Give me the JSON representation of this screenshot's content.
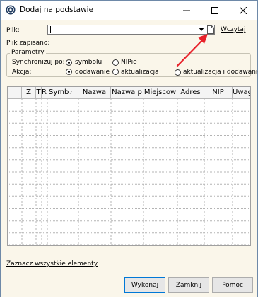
{
  "window": {
    "title": "Dodaj na podstawie",
    "icon": "app-logo-icon"
  },
  "file": {
    "label": "Plik:",
    "value": "",
    "load_label": "Wczytaj",
    "saved_label": "Plik zapisano:"
  },
  "params": {
    "legend": "Parametry",
    "sync_label": "Synchronizuj po:",
    "sync_options": [
      "symbolu",
      "NIPie"
    ],
    "sync_selected": "symbolu",
    "action_label": "Akcja:",
    "action_options": [
      "dodawanie",
      "aktualizacja",
      "aktualizacja i dodawanie"
    ],
    "action_selected": "dodawanie"
  },
  "grid": {
    "columns": [
      "",
      "Z",
      "T",
      "R",
      "Symb",
      "Nazwa",
      "Nazwa p",
      "Miejscow",
      "Adres",
      "NIP",
      "Uwagi"
    ],
    "sort_column": "Symb",
    "row_count": 12
  },
  "select_all_label": "Zaznacz wszystkie elementy",
  "buttons": {
    "execute": "Wykonaj",
    "close": "Zamknij",
    "help": "Pomoc"
  },
  "colors": {
    "window_bg": "#faf6ea",
    "annotation_arrow": "#e8212a",
    "default_button_border": "#0078d7"
  }
}
